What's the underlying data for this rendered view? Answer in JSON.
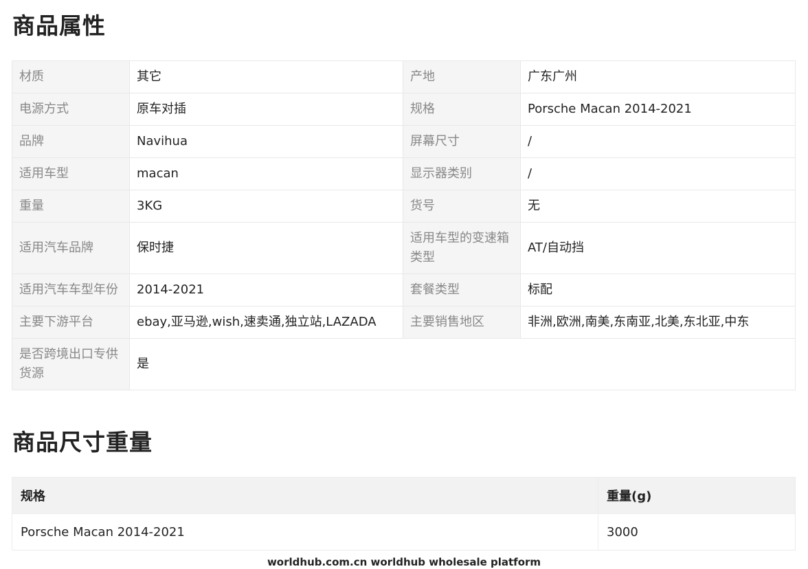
{
  "section_attributes": {
    "title": "商品属性",
    "rows": [
      {
        "k1": "材质",
        "v1": "其它",
        "k2": "产地",
        "v2": "广东广州"
      },
      {
        "k1": "电源方式",
        "v1": "原车对插",
        "k2": "规格",
        "v2": "Porsche Macan 2014-2021"
      },
      {
        "k1": "品牌",
        "v1": "Navihua",
        "k2": "屏幕尺寸",
        "v2": "/"
      },
      {
        "k1": "适用车型",
        "v1": "macan",
        "k2": "显示器类别",
        "v2": "/"
      },
      {
        "k1": "重量",
        "v1": "3KG",
        "k2": "货号",
        "v2": "无"
      },
      {
        "k1": "适用汽车品牌",
        "v1": "保时捷",
        "k2": "适用车型的变速箱类型",
        "v2": "AT/自动挡"
      },
      {
        "k1": "适用汽车车型年份",
        "v1": "2014-2021",
        "k2": "套餐类型",
        "v2": "标配"
      },
      {
        "k1": "主要下游平台",
        "v1": "ebay,亚马逊,wish,速卖通,独立站,LAZADA",
        "k2": "主要销售地区",
        "v2": "非洲,欧洲,南美,东南亚,北美,东北亚,中东"
      }
    ],
    "last_row": {
      "k": "是否跨境出口专供货源",
      "v": "是"
    }
  },
  "section_dimensions": {
    "title": "商品尺寸重量",
    "headers": {
      "spec": "规格",
      "weight": "重量(g)"
    },
    "rows": [
      {
        "spec": "Porsche Macan 2014-2021",
        "weight": "3000"
      }
    ]
  },
  "footer": {
    "text": "worldhub.com.cn worldhub wholesale platform"
  }
}
